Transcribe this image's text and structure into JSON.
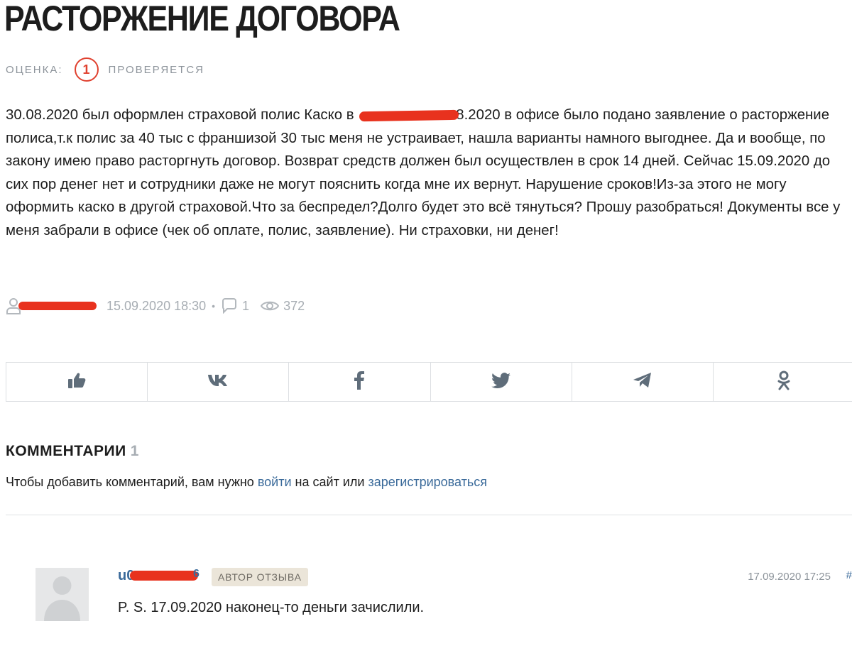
{
  "title": "РАСТОРЖЕНИЕ ДОГОВОРА",
  "rating": {
    "label": "ОЦЕНКА:",
    "value": "1",
    "status": "ПРОВЕРЯЕТСЯ"
  },
  "review": {
    "text_before_redaction": "30.08.2020 был оформлен страховой полис Каско в ",
    "text_after_redaction": "8.2020 в офисе было подано заявление о расторжение полиса,т.к полис за 40 тыс с франшизой 30 тыс меня не устраивает, нашла варианты намного выгоднее. Да и вообще, по закону имею право расторгнуть договор. Возврат средств должен был осуществлен в срок 14 дней. Сейчас 15.09.2020 до сих пор денег нет и сотрудники даже не могут пояснить когда мне их вернут. Нарушение сроков!Из-за этого не могу оформить каско в другой страховой.Что за беспредел?Долго будет это всё тянуться? Прошу разобраться! Документы все у меня забрали в офисе (чек об оплате, полис, заявление). Ни страховки, ни денег!"
  },
  "meta": {
    "date": "15.09.2020 18:30",
    "separator": "•",
    "comments": "1",
    "views": "372"
  },
  "share": {
    "buttons": [
      {
        "name": "like-button",
        "icon": "thumbs-up-icon"
      },
      {
        "name": "share-vk-button",
        "icon": "vk-icon"
      },
      {
        "name": "share-facebook-button",
        "icon": "facebook-icon"
      },
      {
        "name": "share-twitter-button",
        "icon": "twitter-icon"
      },
      {
        "name": "share-telegram-button",
        "icon": "telegram-icon"
      },
      {
        "name": "share-odnoklassniki-button",
        "icon": "odnoklassniki-icon"
      }
    ],
    "icon_color": "#5f6d7a"
  },
  "comments_section": {
    "title": "КОММЕНТАРИИ",
    "count": "1",
    "note_before": "Чтобы добавить комментарий, вам нужно ",
    "login_link": "войти",
    "note_middle": " на сайт или ",
    "register_link": "зарегистрироваться"
  },
  "comment": {
    "author_prefix": "u0",
    "author_suffix": "6",
    "badge": "АВТОР ОТЗЫВА",
    "date": "17.09.2020 17:25",
    "permalink": "#",
    "text": "P. S. 17.09.2020 наконец-то деньги зачислили."
  },
  "colors": {
    "accent_red": "#e0412f",
    "link_blue": "#3a6a9a",
    "muted": "#8d949b",
    "redaction": "#e8321e"
  }
}
